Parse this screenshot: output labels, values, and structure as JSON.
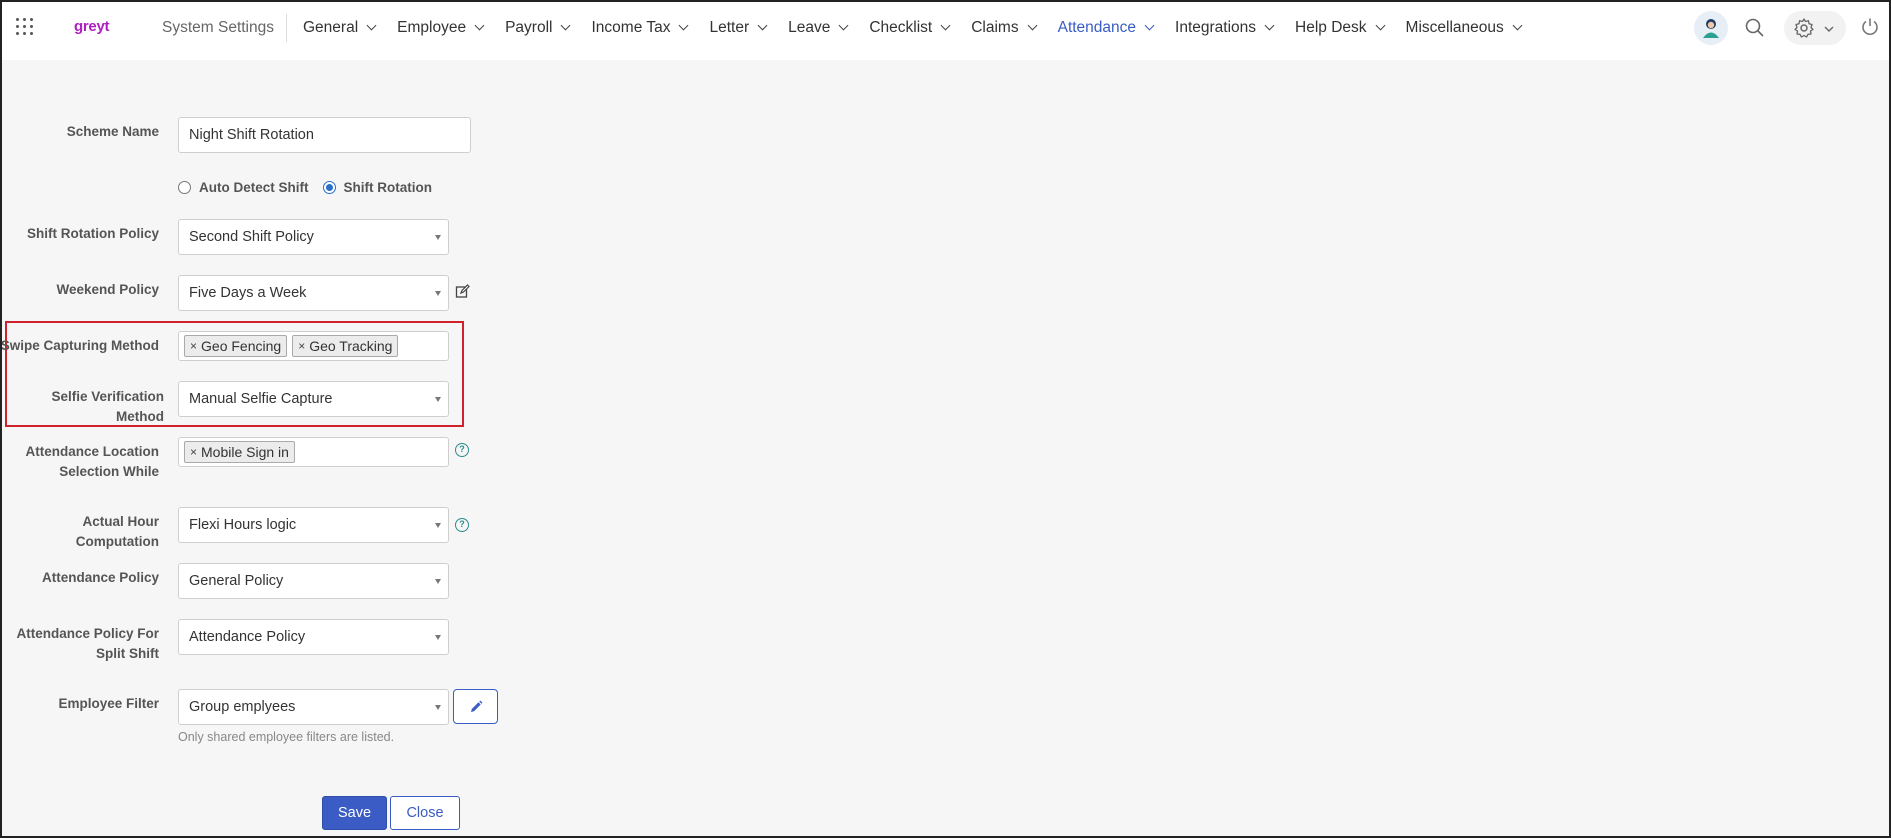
{
  "app": {
    "logo": "greyt"
  },
  "nav": {
    "system_settings": "System Settings",
    "items": [
      {
        "label": "General"
      },
      {
        "label": "Employee"
      },
      {
        "label": "Payroll"
      },
      {
        "label": "Income Tax"
      },
      {
        "label": "Letter"
      },
      {
        "label": "Leave"
      },
      {
        "label": "Checklist"
      },
      {
        "label": "Claims"
      },
      {
        "label": "Attendance",
        "active": true
      },
      {
        "label": "Integrations"
      },
      {
        "label": "Help Desk"
      },
      {
        "label": "Miscellaneous"
      }
    ],
    "icons": [
      "apps-grid-icon",
      "avatar",
      "search-icon",
      "gear-icon",
      "power-icon"
    ],
    "accent_color": "#3a5cc4"
  },
  "form": {
    "scheme_name": {
      "label": "Scheme Name",
      "value": "Night Shift Rotation"
    },
    "mode": {
      "options": [
        {
          "label": "Auto Detect Shift",
          "selected": false
        },
        {
          "label": "Shift Rotation",
          "selected": true
        }
      ]
    },
    "shift_rotation_policy": {
      "label": "Shift Rotation Policy",
      "value": "Second Shift Policy"
    },
    "weekend_policy": {
      "label": "Weekend Policy",
      "value": "Five Days a Week"
    },
    "swipe_capturing_method": {
      "label": "Swipe Capturing Method",
      "tags": [
        "Geo Fencing",
        "Geo Tracking"
      ]
    },
    "selfie_verification_method": {
      "label": "Selfie Verification Method",
      "value": "Manual Selfie Capture"
    },
    "attendance_location": {
      "label_line1": "Attendance Location",
      "label_line2": "Selection While",
      "tags": [
        "Mobile Sign in"
      ]
    },
    "actual_hour_computation": {
      "label": "Actual Hour Computation",
      "value": "Flexi Hours logic"
    },
    "attendance_policy": {
      "label": "Attendance Policy",
      "value": "General Policy"
    },
    "attendance_policy_split": {
      "label_line1": "Attendance Policy For",
      "label_line2": "Split Shift",
      "value": "Attendance Policy"
    },
    "employee_filter": {
      "label": "Employee Filter",
      "value": "Group emplyees",
      "hint": "Only shared employee filters are listed."
    },
    "help_glyph": "?",
    "tag_remove_glyph": "×",
    "save_label": "Save",
    "close_label": "Close",
    "highlight_color": "#d0222c"
  }
}
